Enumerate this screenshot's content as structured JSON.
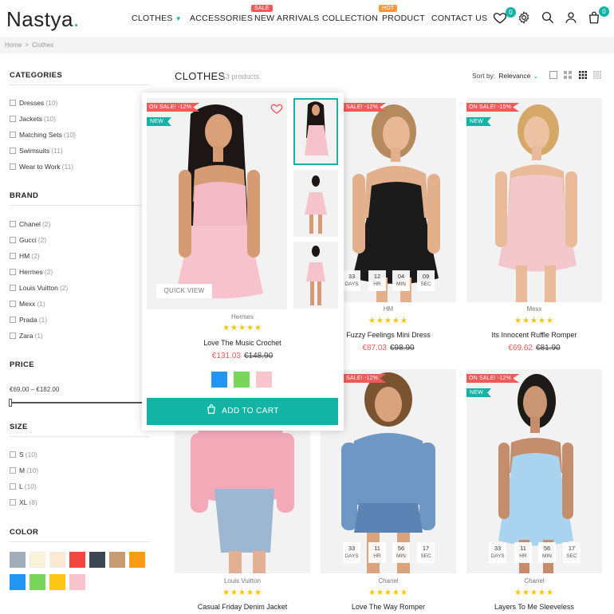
{
  "header": {
    "logo": "Nastya",
    "logo_dot": ".",
    "nav": [
      {
        "label": "CLOTHES",
        "has_caret": true,
        "badge": ""
      },
      {
        "label": "ACCESSORIES",
        "badge": ""
      },
      {
        "label": "NEW ARRIVALS",
        "badge": "SALE"
      },
      {
        "label": "COLLECTION",
        "badge": ""
      },
      {
        "label": "PRODUCT",
        "badge": "HOT"
      },
      {
        "label": "CONTACT US",
        "badge": ""
      }
    ],
    "wishlist_count": "0",
    "cart_count": "0",
    "icons": [
      "heart-icon",
      "gear-icon",
      "search-icon",
      "user-icon",
      "bag-icon"
    ]
  },
  "breadcrumb": {
    "home": "Home",
    "sep": ">",
    "current": "Clothes"
  },
  "sidebar": {
    "categories_title": "CATEGORIES",
    "categories": [
      {
        "label": "Dresses",
        "count": "(10)"
      },
      {
        "label": "Jackets",
        "count": "(10)"
      },
      {
        "label": "Matching Sets",
        "count": "(10)"
      },
      {
        "label": "Swimsuits",
        "count": "(11)"
      },
      {
        "label": "Wear to Work",
        "count": "(11)"
      }
    ],
    "brand_title": "BRAND",
    "brands": [
      {
        "label": "Chanel",
        "count": "(2)"
      },
      {
        "label": "Gucci",
        "count": "(2)"
      },
      {
        "label": "HM",
        "count": "(2)"
      },
      {
        "label": "Hermes",
        "count": "(2)"
      },
      {
        "label": "Louis Vuitton",
        "count": "(2)"
      },
      {
        "label": "Mexx",
        "count": "(1)"
      },
      {
        "label": "Prada",
        "count": "(1)"
      },
      {
        "label": "Zara",
        "count": "(1)"
      }
    ],
    "price_title": "PRICE",
    "price_range": "€69.00 – €182.00",
    "size_title": "SIZE",
    "sizes": [
      {
        "label": "S",
        "count": "(10)"
      },
      {
        "label": "M",
        "count": "(10)"
      },
      {
        "label": "L",
        "count": "(10)"
      },
      {
        "label": "XL",
        "count": "(8)"
      }
    ],
    "color_title": "COLOR",
    "colors": [
      "#a3aebb",
      "#f8f3d9",
      "#fbe9d3",
      "#f1463e",
      "#3b4650",
      "#c79b72",
      "#fb9c16",
      "#2196f3",
      "#7ad55b",
      "#fdc516",
      "#f8c5cf"
    ]
  },
  "listing": {
    "title": "CLOTHES",
    "count": "13 products.",
    "sort_label": "Sort by:",
    "sort_value": "Relevance"
  },
  "products": [
    {
      "brand": "Hermes",
      "name": "Love The Music Crochet",
      "price": "€131.03",
      "old_price": "€148.90",
      "sale": "ON SALE! -12%",
      "new": "NEW",
      "stars": "★★★★★",
      "quick_view": "QUICK VIEW",
      "add_to_cart": "ADD TO CART",
      "colors": [
        "#2196f3",
        "#7ad55b",
        "#f8c5cf"
      ]
    },
    {
      "brand": "HM",
      "name": "Fuzzy Feelings Mini Dress",
      "price": "€87.03",
      "old_price": "€98.90",
      "sale": "ON SALE! -12%",
      "stars": "★★★★★",
      "countdown": [
        {
          "v": "33",
          "u": "DAYS"
        },
        {
          "v": "12",
          "u": "HR"
        },
        {
          "v": "04",
          "u": "MIN"
        },
        {
          "v": "09",
          "u": "SEC"
        }
      ]
    },
    {
      "brand": "Mexx",
      "name": "Its Innocent Ruffle Romper",
      "price": "€69.62",
      "old_price": "€81.90",
      "sale": "ON SALE! -15%",
      "new": "NEW",
      "stars": "★★★★★"
    },
    {
      "brand": "Louis Vuitton",
      "name": "Casual Friday Denim Jacket",
      "stars": "★★★★★"
    },
    {
      "brand": "Chanel",
      "name": "Love The Way Romper",
      "sale": "ON SALE! -12%",
      "stars": "★★★★★",
      "countdown": [
        {
          "v": "33",
          "u": "DAYS"
        },
        {
          "v": "11",
          "u": "HR"
        },
        {
          "v": "56",
          "u": "MIN"
        },
        {
          "v": "17",
          "u": "SEC"
        }
      ]
    },
    {
      "brand": "Chanel",
      "name": "Layers To Me Sleeveless",
      "sale": "ON SALE! -12%",
      "new": "NEW",
      "stars": "★★★★★",
      "countdown": [
        {
          "v": "33",
          "u": "DAYS"
        },
        {
          "v": "11",
          "u": "HR"
        },
        {
          "v": "56",
          "u": "MIN"
        },
        {
          "v": "17",
          "u": "SEC"
        }
      ]
    }
  ]
}
